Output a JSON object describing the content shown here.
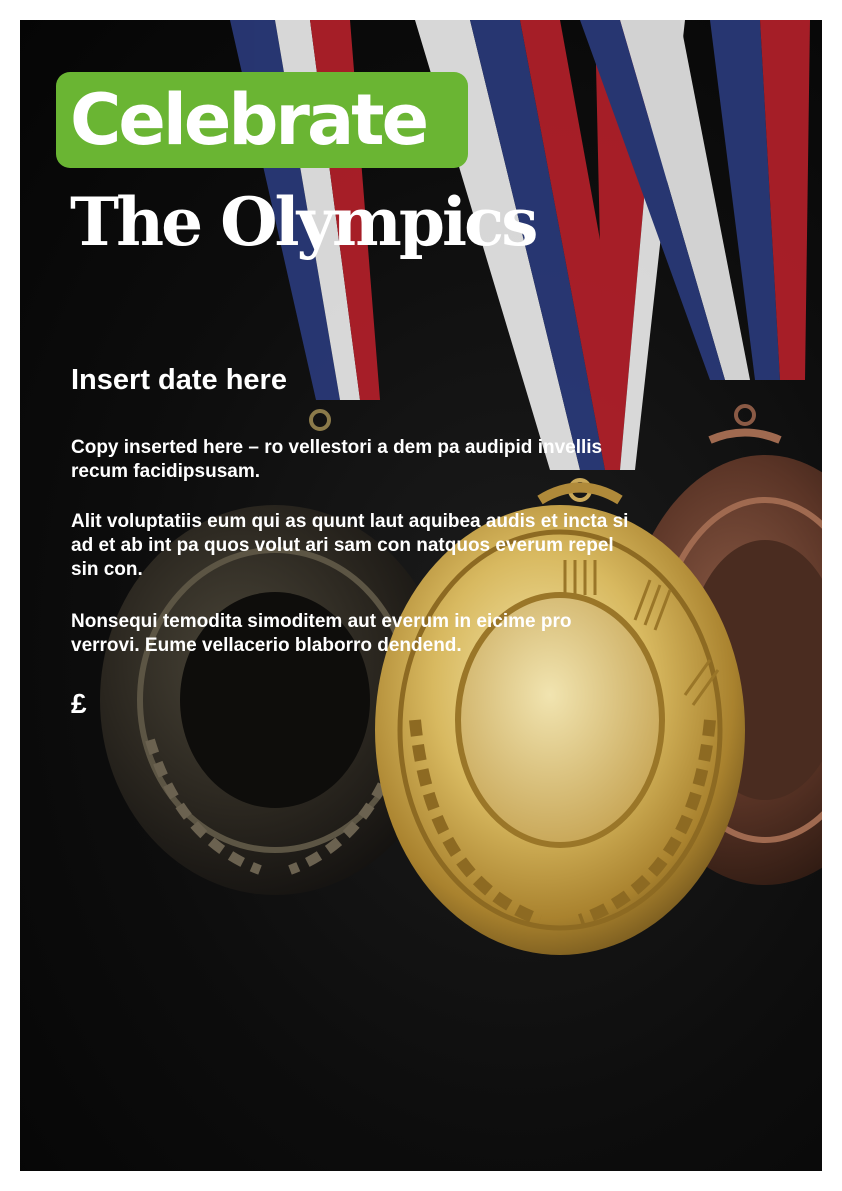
{
  "badge": {
    "text": "Celebrate",
    "color": "#6ab533"
  },
  "title": "The Olympics",
  "date": "Insert date here",
  "copy": [
    "Copy inserted here – ro vellestori a dem pa audipid invellis recum facidipsusam.",
    "Alit voluptatiis eum qui as quunt laut aquibea audis et incta si ad et ab int pa quos volut ari sam con natquos everum repel sin con.",
    "Nonsequi temodita simoditem aut everum in eicime pro verrovi. Eume vellacerio blaborro dendend."
  ],
  "price": "£",
  "image": {
    "subject": "gold-silver-bronze-medals-on-ribbons",
    "background": "#0d0d0d",
    "ribbon_colors": [
      "#b3202a",
      "#f2f2f2",
      "#2a3a7a"
    ]
  }
}
